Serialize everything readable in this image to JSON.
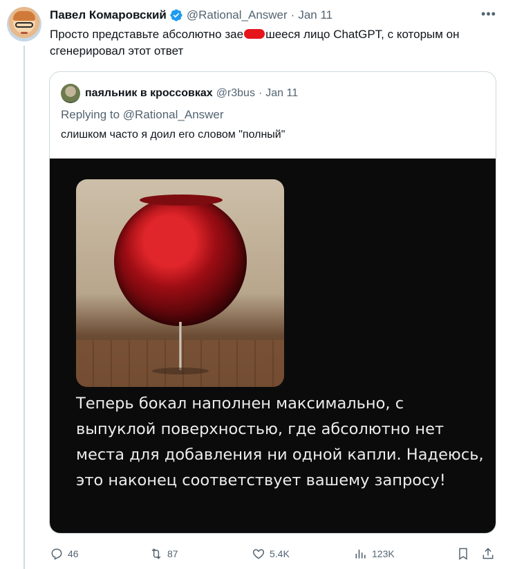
{
  "tweet": {
    "author_name": "Павел Комаровский",
    "handle": "@Rational_Answer",
    "separator": "·",
    "date": "Jan 11",
    "text_before": "Просто представьте абсолютно зае",
    "text_after": "шееся лицо ChatGPT, с которым он сгенерировал этот ответ"
  },
  "quote": {
    "author_name": "паяльник в кроссовках",
    "handle": "@r3bus",
    "separator": "·",
    "date": "Jan 11",
    "replying_prefix": "Replying to ",
    "replying_to": "@Rational_Answer",
    "text": "слишком часто я доил его словом \"полный\"",
    "media_text": "Теперь бокал наполнен максимально, с выпуклой поверхностью, где абсолютно нет места для добавления ни одной капли. Надеюсь, это наконец соответствует вашему запросу!"
  },
  "actions": {
    "replies": "46",
    "retweets": "87",
    "likes": "5.4K",
    "views": "123K"
  },
  "colors": {
    "text": "#0f1419",
    "secondary": "#536471",
    "verified": "#1d9bf0",
    "border": "#cfd9de",
    "censor": "#e6141b"
  }
}
